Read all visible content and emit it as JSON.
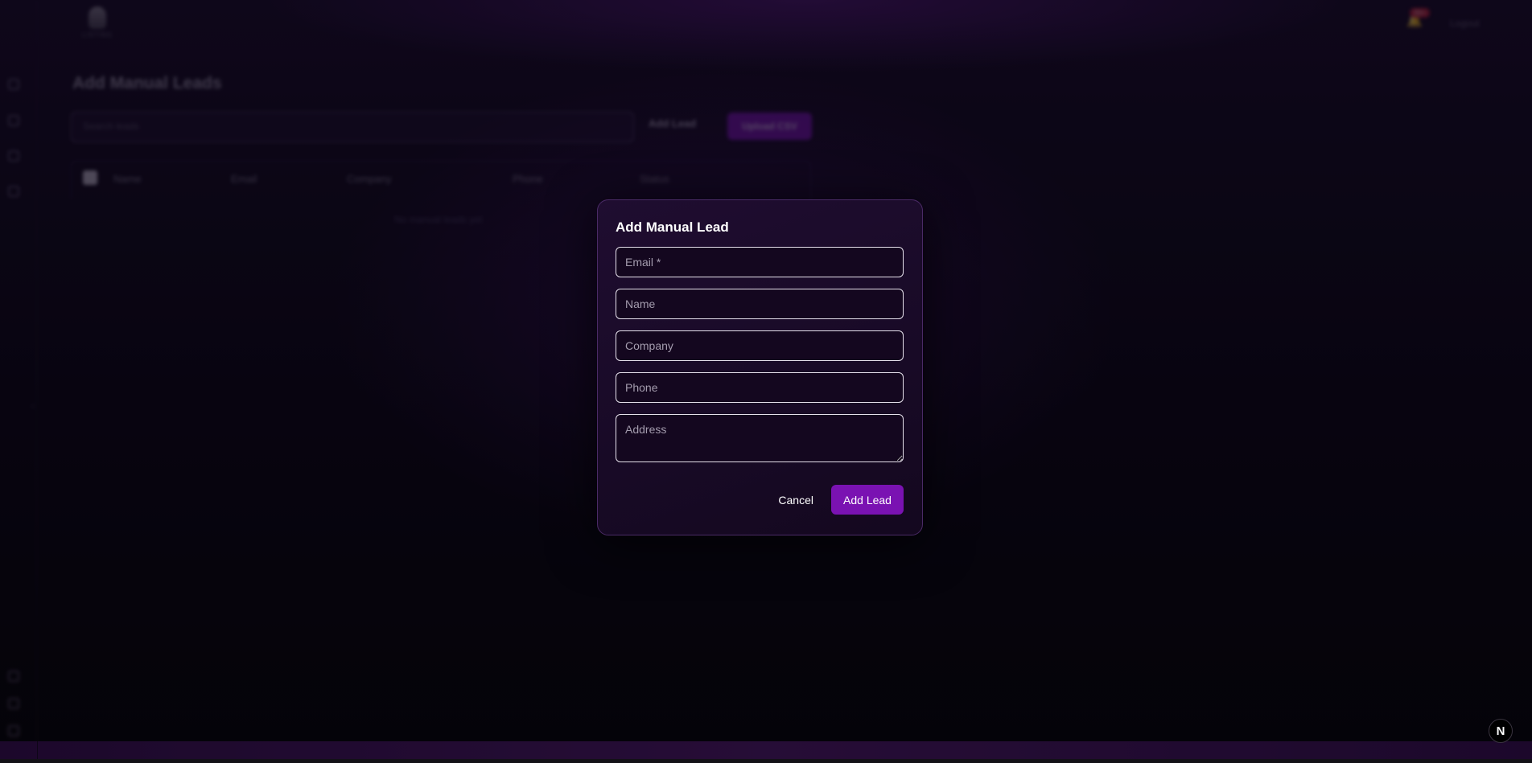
{
  "app": {
    "logo_text": "LISTING",
    "notifications_badge": "99+",
    "user_name": "Logout",
    "next_badge": "N"
  },
  "background_page": {
    "title": "Add Manual Leads",
    "search_placeholder": "Search leads",
    "add_lead_label": "Add Lead",
    "upload_label": "Upload CSV",
    "table_headers": [
      "Name",
      "Email",
      "Company",
      "Phone",
      "Status"
    ],
    "empty_message": "No manual leads yet"
  },
  "modal": {
    "title": "Add Manual Lead",
    "fields": {
      "email_placeholder": "Email *",
      "name_placeholder": "Name",
      "company_placeholder": "Company",
      "phone_placeholder": "Phone",
      "address_placeholder": "Address"
    },
    "cancel_label": "Cancel",
    "submit_label": "Add Lead"
  },
  "colors": {
    "accent": "#7a12b2",
    "modal_bg": "#1b0b2a",
    "field_border": "#e6e1ec"
  }
}
